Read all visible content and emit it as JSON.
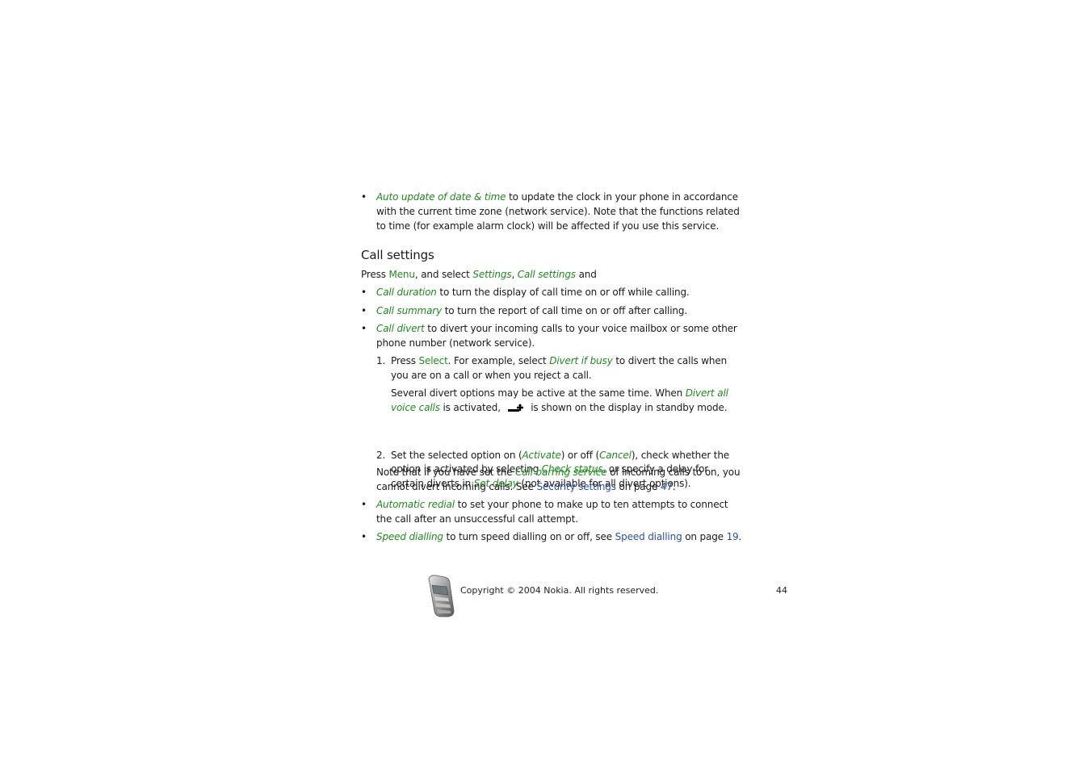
{
  "intro_bullet": {
    "term": "Auto update of date & time",
    "text": " to update the clock in your phone in accordance with the current time zone (network service). Note that the functions related to time (for example alarm clock) will be affected if you use this service."
  },
  "section": {
    "title": "Call settings",
    "intro": {
      "p1": "Press ",
      "key": "Menu",
      "p2": ", and select ",
      "t1": "Settings",
      "sep": ", ",
      "t2": "Call settings",
      "p3": " and"
    },
    "bullets": [
      {
        "term": "Call duration",
        "text": " to turn the display of call time on or off while calling."
      },
      {
        "term": "Call summary",
        "text": " to turn the report of call time on or off after calling."
      },
      {
        "term": "Call divert",
        "text": " to divert your incoming calls to your voice mailbox or some other phone number (network service)."
      }
    ],
    "steps": [
      {
        "num": "1.",
        "p1": "Press ",
        "key": "Select",
        "p2": ". For example, select ",
        "term": "Divert if busy",
        "p3": " to divert the calls when you are on a call or when you reject a call."
      },
      {
        "num": "2.",
        "p1": "Set the selected option on (",
        "t1": "Activate",
        "p2": ") or off (",
        "t2": "Cancel",
        "p3": "), check whether the option is activated by selecting ",
        "t3": "Check status",
        "p4": ", or specify a delay for certain diverts in ",
        "t4": "Set delay",
        "p5": " (not available for all divert options)."
      }
    ],
    "step1_note": {
      "p1": "Several divert options may be active at the same time. When ",
      "term": "Divert all voice calls",
      "p2": " is activated, ",
      "icon": "divert-icon",
      "p3": " is shown on the display in standby mode."
    },
    "barring_note": {
      "p1": "Note that if you have set the ",
      "term": "Call barring service",
      "p2": " of incoming calls to on, you cannot divert incoming calls. See ",
      "link": "Security settings",
      "p3": " on page ",
      "page": "47",
      "p4": "."
    },
    "bullets_after": [
      {
        "term": "Automatic redial",
        "text": " to set your phone to make up to ten attempts to connect the call after an unsuccessful call attempt."
      },
      {
        "term": "Speed dialling",
        "text": " to turn speed dialling on or off, see ",
        "link": "Speed dialling",
        "p2": " on page ",
        "page": "19",
        "p3": "."
      }
    ]
  },
  "footer": {
    "copyright": "Copyright © 2004 Nokia. All rights reserved.",
    "page_number": "44"
  },
  "colors": {
    "term_green": "#1f8a1f",
    "link_blue": "#2a4ea0"
  }
}
